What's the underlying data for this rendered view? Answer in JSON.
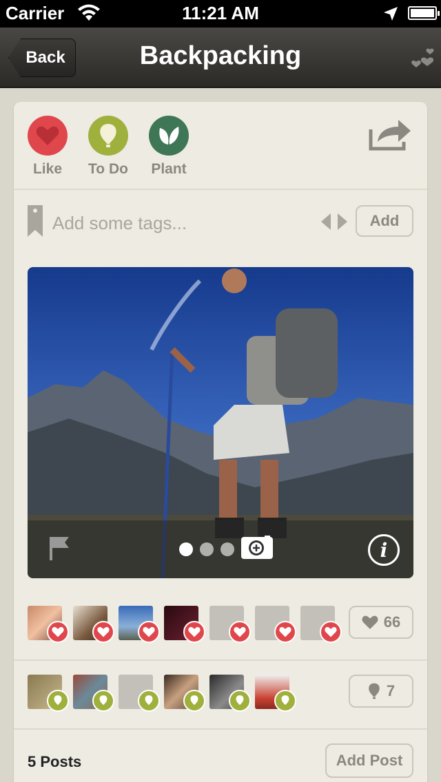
{
  "status_bar": {
    "carrier": "Carrier",
    "time": "11:21 AM"
  },
  "nav": {
    "back_label": "Back",
    "title": "Backpacking"
  },
  "actions": [
    {
      "label": "Like",
      "color": "#e0474c",
      "icon": "heart-icon"
    },
    {
      "label": "To Do",
      "color": "#a0b03d",
      "icon": "balloon-icon"
    },
    {
      "label": "Plant",
      "color": "#3f7656",
      "icon": "leaf-icon"
    }
  ],
  "tags": {
    "placeholder": "Add some tags...",
    "add_label": "Add"
  },
  "photo": {
    "page_count": 3,
    "current_page": 1
  },
  "likes": {
    "count": "66",
    "avatars": [
      "user-1",
      "user-2",
      "user-3",
      "user-4",
      "placeholder",
      "placeholder",
      "placeholder"
    ]
  },
  "todos": {
    "count": "7",
    "avatars": [
      "user-5",
      "user-6",
      "placeholder",
      "user-7",
      "user-8",
      "user-9"
    ]
  },
  "posts": {
    "label": "5 Posts",
    "add_label": "Add Post"
  },
  "colors": {
    "like": "#e0474c",
    "todo": "#a0b03d",
    "plant": "#3f7656",
    "background": "#d9d6cb",
    "card": "#edebe2"
  }
}
